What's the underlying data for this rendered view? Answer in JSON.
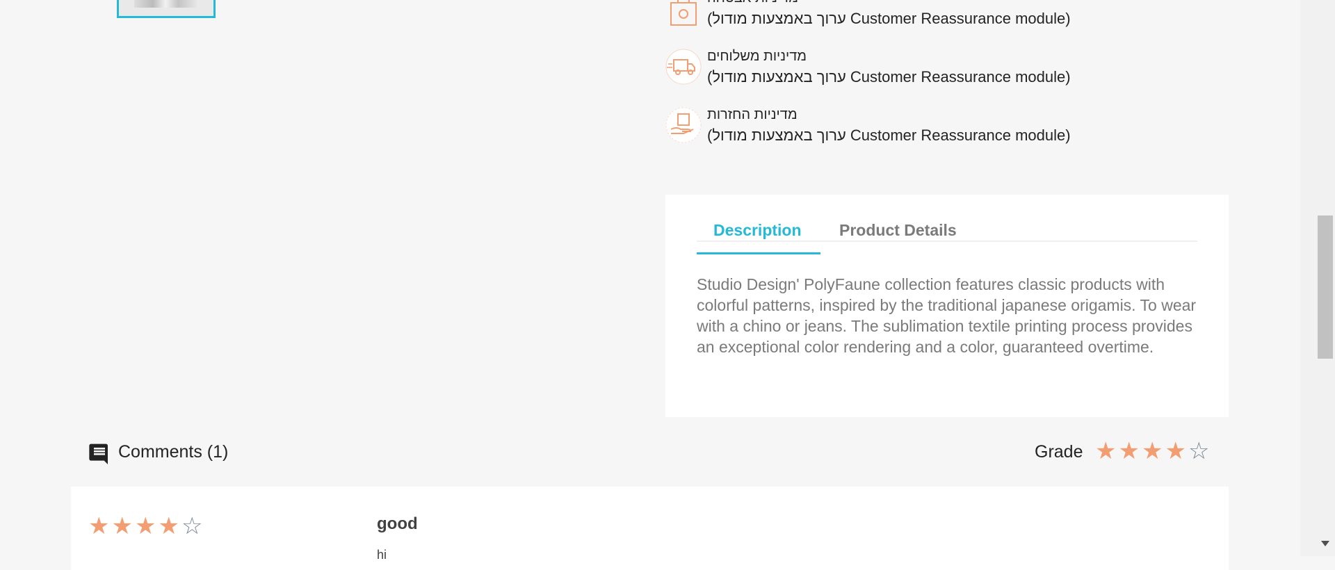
{
  "reassurance": [
    {
      "title": "מדיניות אבטחה",
      "desc": "(ערוך באמצעות מודול Customer Reassurance module)",
      "icon": "security-bag-icon"
    },
    {
      "title": "מדיניות משלוחים",
      "desc": "(ערוך באמצעות מודול Customer Reassurance module)",
      "icon": "delivery-truck-icon"
    },
    {
      "title": "מדיניות החזרות",
      "desc": "(ערוך באמצעות מודול Customer Reassurance module)",
      "icon": "return-box-icon"
    }
  ],
  "tabs": {
    "description": "Description",
    "product_details": "Product Details"
  },
  "description_text": "Studio Design' PolyFaune collection features classic products with colorful patterns, inspired by the traditional japanese origamis. To wear with a chino or jeans. The sublimation textile printing process provides an exceptional color rendering and a color, guaranteed overtime.",
  "comments": {
    "label": "Comments (1)",
    "grade_label": "Grade",
    "grade": 4,
    "grade_max": 5
  },
  "review": {
    "rating": 4,
    "rating_max": 5,
    "title": "good",
    "body": "hi"
  },
  "colors": {
    "accent": "#24b9d7",
    "star": "#f39d72",
    "icon": "#f39d72"
  }
}
